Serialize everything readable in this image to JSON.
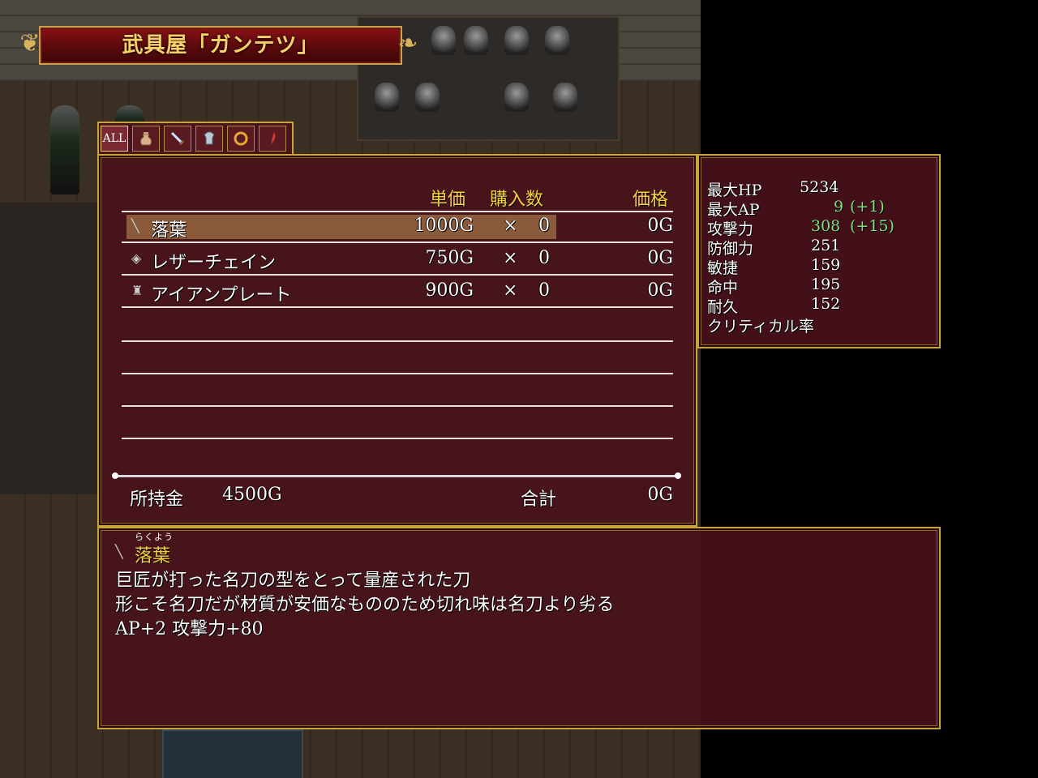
{
  "shop_title": "武具屋「ガンテツ」",
  "tabs": [
    {
      "label": "ALL",
      "icon": "all"
    },
    {
      "label": "",
      "icon": "bag-icon"
    },
    {
      "label": "",
      "icon": "sword-icon"
    },
    {
      "label": "",
      "icon": "armor-icon"
    },
    {
      "label": "",
      "icon": "ring-icon"
    },
    {
      "label": "",
      "icon": "fang-icon"
    }
  ],
  "headers": {
    "unit_price": "単価",
    "purchase_qty": "購入数",
    "price": "価格"
  },
  "items": [
    {
      "icon": "sword-icon",
      "name": "落葉",
      "unit_price": "1000G",
      "times": "×",
      "qty": "0",
      "total": "0G",
      "selected": true
    },
    {
      "icon": "leather-armor-icon",
      "name": "レザーチェイン",
      "unit_price": "750G",
      "times": "×",
      "qty": "0",
      "total": "0G",
      "selected": false
    },
    {
      "icon": "plate-armor-icon",
      "name": "アイアンプレート",
      "unit_price": "900G",
      "times": "×",
      "qty": "0",
      "total": "0G",
      "selected": false
    }
  ],
  "footer": {
    "money_label": "所持金",
    "money_value": "4500G",
    "sum_label": "合計",
    "sum_value": "0G"
  },
  "stats": [
    {
      "label": "最大HP",
      "value": "5234",
      "bonus": ""
    },
    {
      "label": "最大AP",
      "value": "9",
      "bonus": "(+1)"
    },
    {
      "label": "攻撃力",
      "value": "308",
      "bonus": "(+15)"
    },
    {
      "label": "防御力",
      "value": "251",
      "bonus": ""
    },
    {
      "label": "敏捷",
      "value": "159",
      "bonus": ""
    },
    {
      "label": "命中",
      "value": "195",
      "bonus": ""
    },
    {
      "label": "耐久",
      "value": "152",
      "bonus": ""
    },
    {
      "label": "クリティカル率",
      "value": "",
      "bonus": ""
    }
  ],
  "description": {
    "item_name": "落葉",
    "item_reading": "らくよう",
    "lines": [
      "巨匠が打った名刀の型をとって量産された刀",
      "形こそ名刀だが材質が安価なもののため切れ味は名刀より劣る",
      "AP+2 攻撃力+80"
    ]
  },
  "colors": {
    "window_bg": "#4a121c",
    "border": "#c9a43c",
    "highlight": "#8a5a3a",
    "header_text": "#f4d03f",
    "bonus_text": "#7ee07e"
  }
}
